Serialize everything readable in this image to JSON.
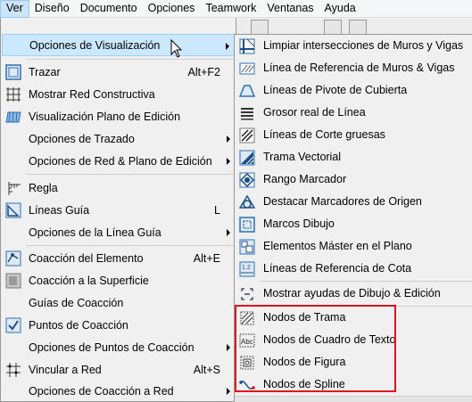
{
  "menubar": {
    "items": [
      "Ver",
      "Diseño",
      "Documento",
      "Opciones",
      "Teamwork",
      "Ventanas",
      "Ayuda"
    ]
  },
  "menu": {
    "items": [
      {
        "label": "Opciones de Visualización",
        "shortcut": "",
        "icon": "",
        "submenu": true
      },
      {
        "label": "Trazar",
        "shortcut": "Alt+F2",
        "icon": "trace-icon",
        "submenu": false
      },
      {
        "label": "Mostrar Red Constructiva",
        "shortcut": "",
        "icon": "grid-icon",
        "submenu": false
      },
      {
        "label": "Visualización Plano de Edición",
        "shortcut": "",
        "icon": "edit-plane-icon",
        "submenu": false
      },
      {
        "label": "Opciones de Trazado",
        "shortcut": "",
        "icon": "",
        "submenu": true
      },
      {
        "label": "Opciones de Red & Plano de Edición",
        "shortcut": "",
        "icon": "",
        "submenu": true
      },
      {
        "label": "Regla",
        "shortcut": "",
        "icon": "ruler-icon",
        "submenu": false
      },
      {
        "label": "Líneas Guía",
        "shortcut": "L",
        "icon": "guide-lines-icon",
        "submenu": false
      },
      {
        "label": "Opciones de la Línea Guía",
        "shortcut": "",
        "icon": "",
        "submenu": true
      },
      {
        "label": "Coacción del Elemento",
        "shortcut": "Alt+E",
        "icon": "element-snap-icon",
        "submenu": false
      },
      {
        "label": "Coacción a la Superficie",
        "shortcut": "",
        "icon": "surface-snap-icon",
        "submenu": false
      },
      {
        "label": "Guías de Coacción",
        "shortcut": "",
        "icon": "",
        "submenu": false
      },
      {
        "label": "Puntos de Coacción",
        "shortcut": "",
        "icon": "snap-points-icon",
        "submenu": false
      },
      {
        "label": "Opciones de Puntos de Coacción",
        "shortcut": "",
        "icon": "",
        "submenu": true
      },
      {
        "label": "Vincular a Red",
        "shortcut": "Alt+S",
        "icon": "snap-grid-icon",
        "submenu": false
      },
      {
        "label": "Opciones de Coacción a Red",
        "shortcut": "",
        "icon": "",
        "submenu": true
      }
    ]
  },
  "submenu": {
    "items": [
      {
        "label": "Limpiar intersecciones de Muros y Vigas",
        "icon": "clean-intersections-icon"
      },
      {
        "label": "Línea de Referencia de Muros & Vigas",
        "icon": "reference-line-icon"
      },
      {
        "label": "Líneas de Pivote de Cubierta",
        "icon": "roof-pivot-icon"
      },
      {
        "label": "Grosor real de Línea",
        "icon": "line-weight-icon"
      },
      {
        "label": "Líneas de Corte gruesas",
        "icon": "bold-cut-lines-icon"
      },
      {
        "label": "Trama Vectorial",
        "icon": "vector-hatch-icon"
      },
      {
        "label": "Rango Marcador",
        "icon": "marker-range-icon"
      },
      {
        "label": "Destacar Marcadores de Origen",
        "icon": "source-markers-icon"
      },
      {
        "label": "Marcos Dibujo",
        "icon": "drawing-frames-icon"
      },
      {
        "label": "Elementos Máster en el Plano",
        "icon": "master-elements-icon"
      },
      {
        "label": "Líneas de Referencia de Cota",
        "icon": "dimension-reference-icon"
      },
      {
        "label": "Mostrar ayudas de Dibujo & Edición",
        "icon": "drawing-aids-icon"
      },
      {
        "label": "Nodos de Trama",
        "icon": "hatch-nodes-icon"
      },
      {
        "label": "Nodos de Cuadro de Texto",
        "icon": "text-nodes-icon"
      },
      {
        "label": "Nodos de Figura",
        "icon": "figure-nodes-icon"
      },
      {
        "label": "Nodos de Spline",
        "icon": "spline-nodes-icon"
      }
    ]
  },
  "colors": {
    "highlight": "#cce8ff",
    "annotation_box": "#e0141e",
    "icon_blue": "#2a6fb6"
  }
}
